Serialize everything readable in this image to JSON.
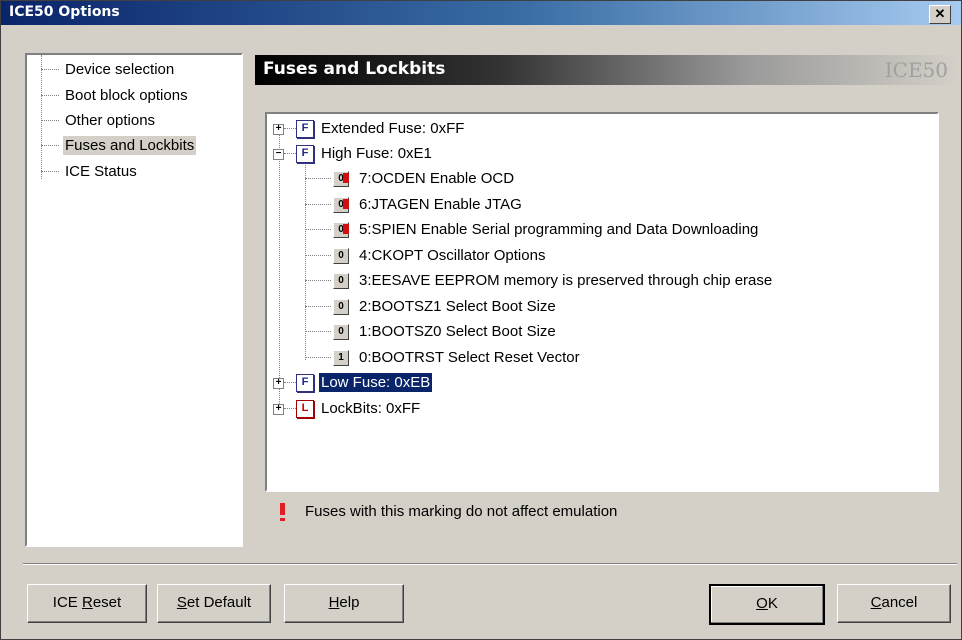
{
  "window": {
    "title": "ICE50 Options",
    "close_label": "✕"
  },
  "nav": {
    "items": [
      {
        "label": "Device selection"
      },
      {
        "label": "Boot block options"
      },
      {
        "label": "Other options"
      },
      {
        "label": "Fuses and Lockbits",
        "selected": true
      },
      {
        "label": "ICE Status"
      }
    ]
  },
  "header": {
    "title": "Fuses and Lockbits",
    "brand": "ICE50"
  },
  "tree": {
    "nodes": [
      {
        "label": "Extended Fuse:  0xFF",
        "icon": "F",
        "expand": "+"
      },
      {
        "label": "High Fuse:  0xE1",
        "icon": "F",
        "expand": "−",
        "children": [
          {
            "label": "7:OCDEN Enable OCD",
            "bit": "0",
            "no_emulation": true
          },
          {
            "label": "6:JTAGEN Enable JTAG",
            "bit": "0",
            "no_emulation": true
          },
          {
            "label": "5:SPIEN Enable Serial programming and Data Downloading",
            "bit": "0",
            "no_emulation": true
          },
          {
            "label": "4:CKOPT Oscillator Options",
            "bit": "0"
          },
          {
            "label": "3:EESAVE EEPROM memory is preserved through chip erase",
            "bit": "0"
          },
          {
            "label": "2:BOOTSZ1 Select Boot Size",
            "bit": "0"
          },
          {
            "label": "1:BOOTSZ0 Select Boot Size",
            "bit": "0"
          },
          {
            "label": "0:BOOTRST Select Reset Vector",
            "bit": "1"
          }
        ]
      },
      {
        "label": "Low Fuse:  0xEB",
        "icon": "F",
        "expand": "+",
        "selected": true
      },
      {
        "label": "LockBits:  0xFF",
        "icon": "L",
        "expand": "+"
      }
    ]
  },
  "note": "Fuses with this marking do not affect emulation",
  "buttons": {
    "ice_reset": {
      "pre": "ICE ",
      "accel": "R",
      "post": "eset"
    },
    "set_default": {
      "pre": "",
      "accel": "S",
      "post": "et Default"
    },
    "help": {
      "pre": "",
      "accel": "H",
      "post": "elp"
    },
    "ok": {
      "pre": "",
      "accel": "O",
      "post": "K"
    },
    "cancel": {
      "pre": "",
      "accel": "C",
      "post": "ancel"
    }
  },
  "colors": {
    "selection": "#0a246a",
    "no_emulation_mark": "#d01010",
    "face": "#d4d0c8"
  }
}
